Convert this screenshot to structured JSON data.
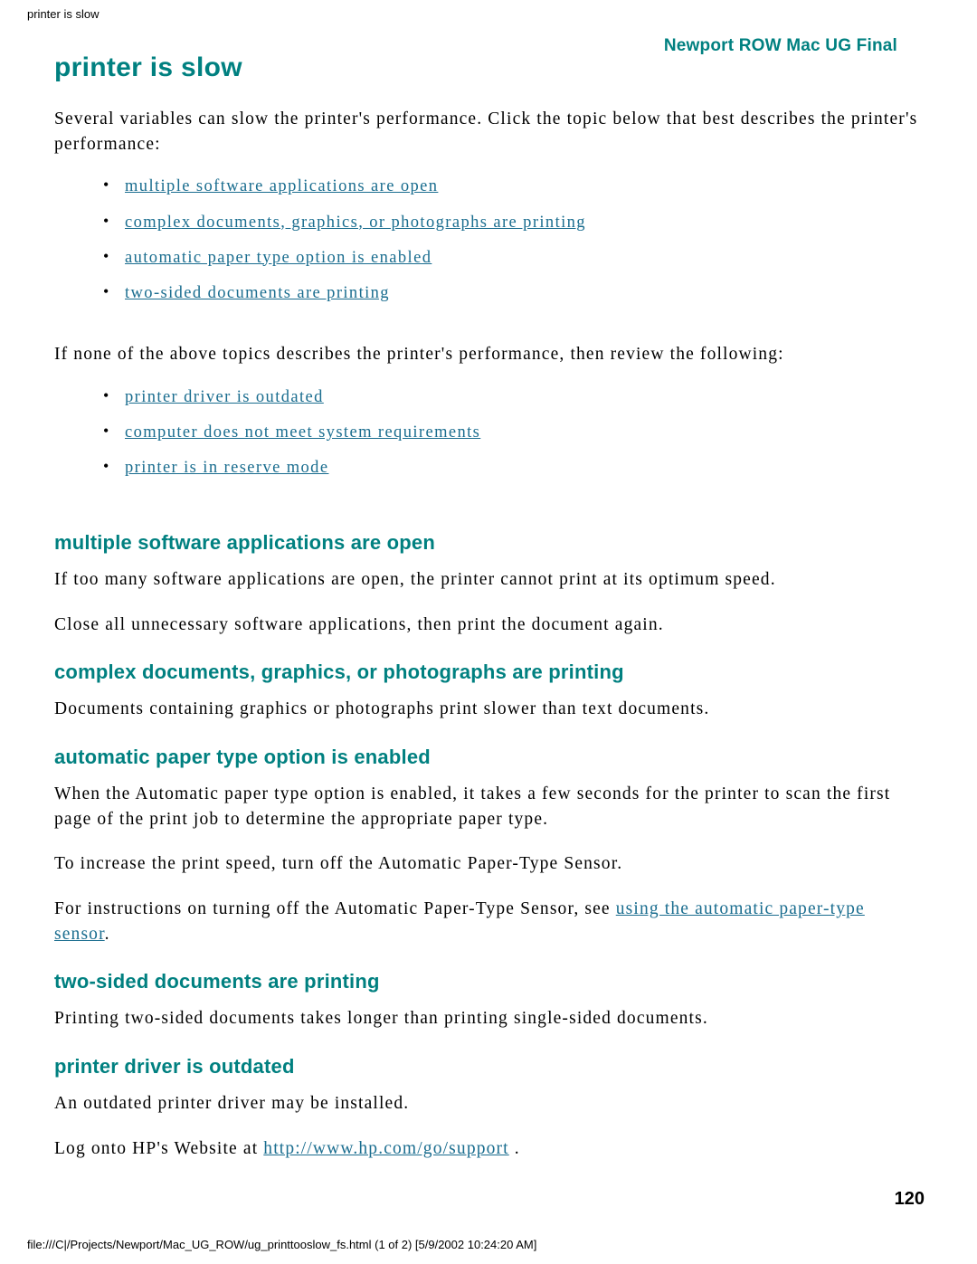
{
  "browser": {
    "header_title": "printer is slow",
    "footer_status": "file:///C|/Projects/Newport/Mac_UG_ROW/ug_printtooslow_fs.html (1 of 2) [5/9/2002 10:24:20 AM]"
  },
  "doc": {
    "running_header": "Newport ROW Mac UG Final",
    "page_number": "120",
    "title": "printer is slow",
    "intro": "Several variables can slow the printer's performance. Click the topic below that best describes the printer's performance:",
    "topic_links_primary": [
      "multiple software applications are open",
      "complex documents, graphics, or photographs are printing",
      "automatic paper type option is enabled",
      "two-sided documents are printing"
    ],
    "secondary_intro": "If none of the above topics describes the printer's performance, then review the following:",
    "topic_links_secondary": [
      "printer driver is outdated",
      "computer does not meet system requirements",
      "printer is in reserve mode"
    ],
    "sections": [
      {
        "heading": "multiple software applications are open",
        "paragraphs": [
          "If too many software applications are open, the printer cannot print at its optimum speed.",
          "Close all unnecessary software applications, then print the document again."
        ]
      },
      {
        "heading": "complex documents, graphics, or photographs are printing",
        "paragraphs": [
          "Documents containing graphics or photographs print slower than text documents."
        ]
      },
      {
        "heading": "automatic paper type option is enabled",
        "paragraphs": [
          "When the Automatic paper type option is enabled, it takes a few seconds for the printer to scan the first page of the print job to determine the appropriate paper type.",
          "To increase the print speed, turn off the Automatic Paper-Type Sensor."
        ],
        "link_paragraph": {
          "prefix": "For instructions on turning off the Automatic Paper-Type Sensor, see ",
          "link_text": "using the automatic paper-type sensor",
          "suffix": "."
        }
      },
      {
        "heading": "two-sided documents are printing",
        "paragraphs": [
          "Printing two-sided documents takes longer than printing single-sided documents."
        ]
      },
      {
        "heading": "printer driver is outdated",
        "paragraphs": [
          "An outdated printer driver may be installed."
        ],
        "link_paragraph": {
          "prefix": "Log onto HP's Website at ",
          "link_text": "http://www.hp.com/go/support",
          "suffix": " ."
        }
      }
    ]
  },
  "colors": {
    "heading": "#008080",
    "link": "#1a6d8f"
  }
}
